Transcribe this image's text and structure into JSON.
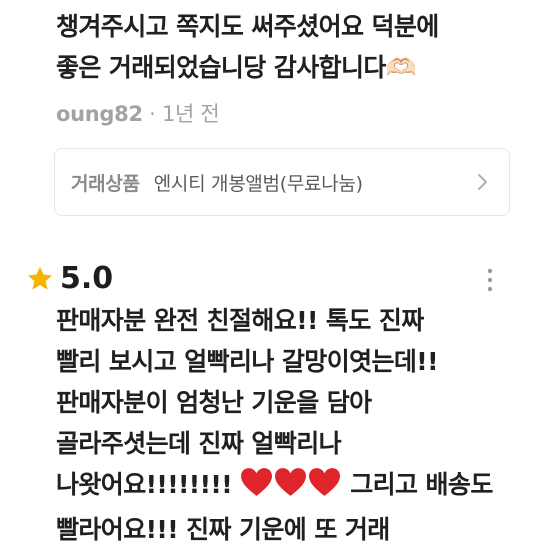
{
  "review_1": {
    "lines": [
      "챙겨주시고 쪽지도 써주셨어요 덕분에",
      "좋은 거래되었습니당 감사합니다🫶🏻"
    ],
    "username": "oung82",
    "separator": " · ",
    "time": "1년 전"
  },
  "product": {
    "label": "거래상품",
    "name": "엔시티 개봉앨범(무료나눔)"
  },
  "review_2": {
    "rating": "5.0",
    "lines": [
      "판매자분 완전 친절해요!! 톡도 진짜",
      "빨리 보시고 얼빡리나 갈망이엿는데!!",
      "판매자분이 엄청난 기운을 담아",
      "골라주셧는데 진짜 얼빡리나"
    ],
    "line5_before": "나왓어요!!!!!!!! ",
    "line5_after": " 그리고 배송도",
    "line6_partial": "빨라어요!!! 진짜 기운에 또 거래"
  },
  "colors": {
    "star": "#f7b500",
    "heart": "#e0242c",
    "meta": "#a3a3a3",
    "border": "#e6e6e6"
  },
  "icons": [
    "star-icon",
    "more-options-icon",
    "chevron-right-icon",
    "heart-emoji-icon",
    "heart-hands-emoji"
  ]
}
